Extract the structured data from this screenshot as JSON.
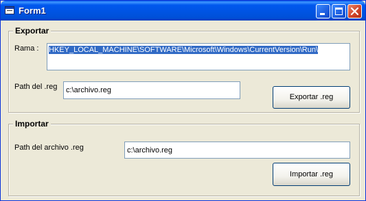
{
  "window": {
    "title": "Form1",
    "icon": "vb-form-icon"
  },
  "titlebar_buttons": [
    "minimize-icon",
    "maximize-icon",
    "close-icon"
  ],
  "exportar": {
    "label": "Exportar",
    "rama_label": "Rama :",
    "rama_value": "HKEY_LOCAL_MACHINE\\SOFTWARE\\Microsoft\\Windows\\CurrentVersion\\Run\\",
    "path_label": "Path del .reg",
    "path_value": "c:\\archivo.reg",
    "button_label": "Exportar .reg"
  },
  "importar": {
    "label": "Importar",
    "path_label": "Path del archivo .reg",
    "path_value": "c:\\archivo.reg",
    "button_label": "Importar .reg"
  },
  "colors": {
    "titlebar": "#0054e3",
    "face": "#ece9d8",
    "selection": "#316ac5"
  }
}
